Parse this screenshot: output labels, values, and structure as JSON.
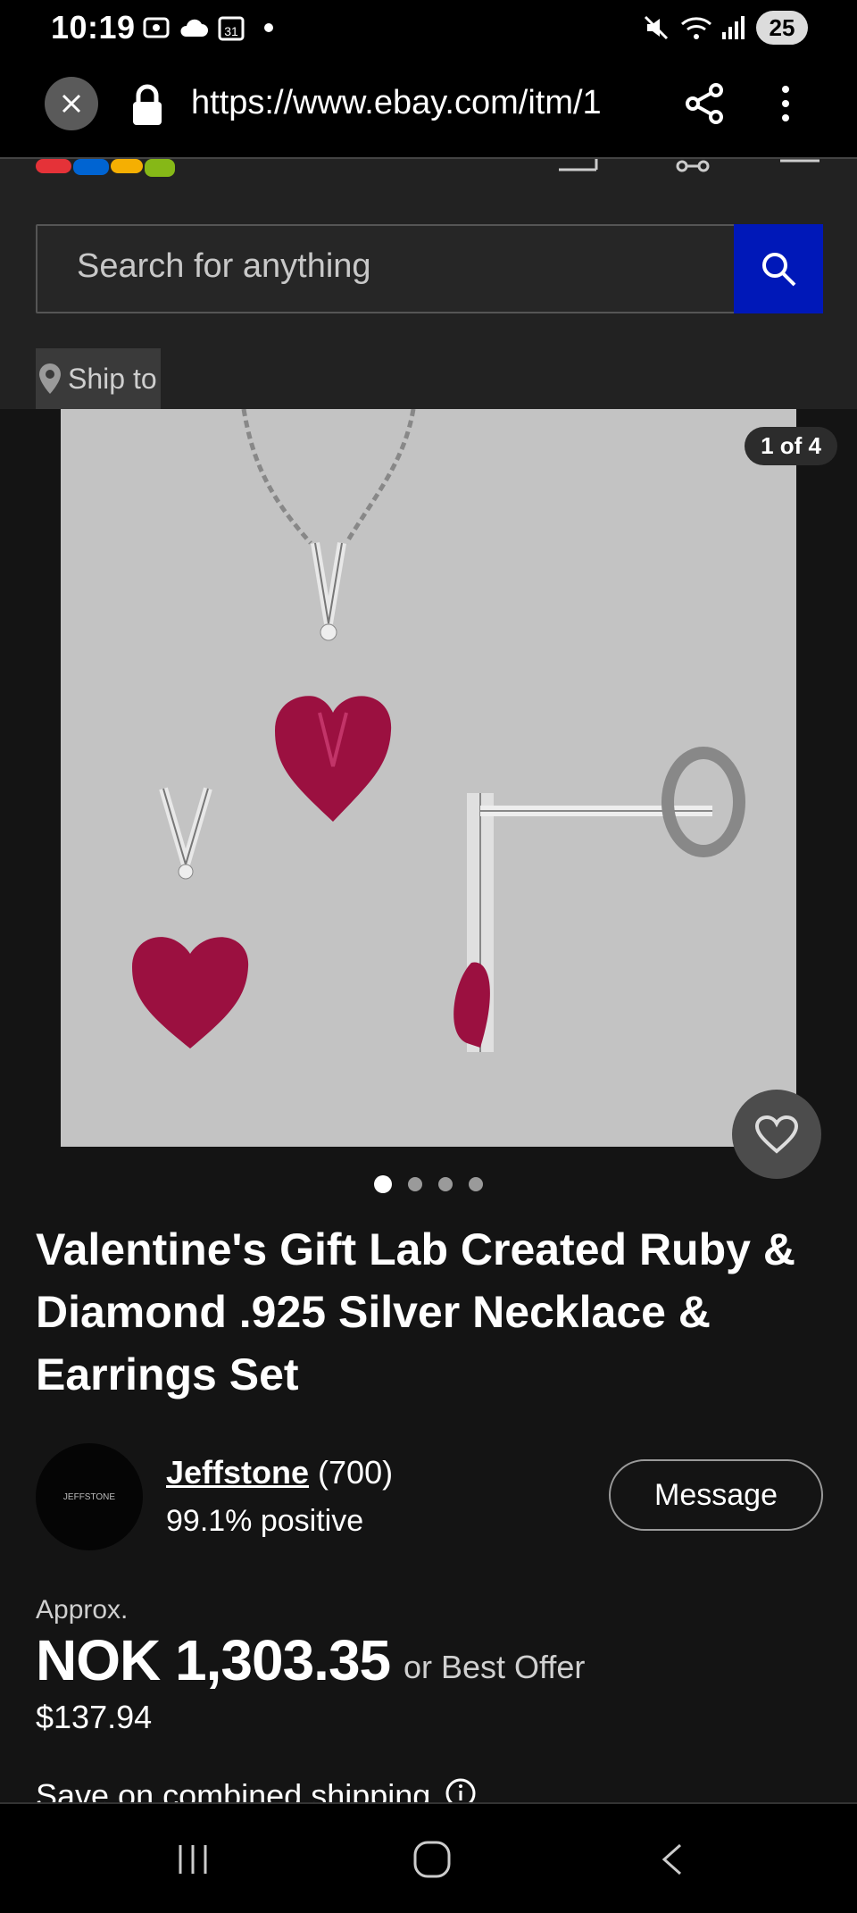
{
  "status": {
    "time": "10:19",
    "battery": "25"
  },
  "browser": {
    "url": "https://www.ebay.com/itm/1"
  },
  "header": {
    "search_placeholder": "Search for anything",
    "ship_to_label": "Ship to"
  },
  "gallery": {
    "counter": "1 of 4",
    "dot_count": 4,
    "active_dot": 0
  },
  "product": {
    "title": "Valentine's Gift Lab Created Ruby & Diamond .925 Silver Necklace & Earrings Set"
  },
  "seller": {
    "name": "Jeffstone",
    "feedback_count": "(700)",
    "positive": "99.1% positive",
    "logo_text": "JEFFSTONE",
    "message_label": "Message"
  },
  "price": {
    "approx_label": "Approx.",
    "amount": "NOK 1,303.35",
    "best_offer": "or Best Offer",
    "usd": "$137.94"
  },
  "shipping": {
    "label": "Save on combined shipping"
  },
  "colors": {
    "search_button": "#0018b8",
    "background": "#141414",
    "header": "#222222"
  }
}
